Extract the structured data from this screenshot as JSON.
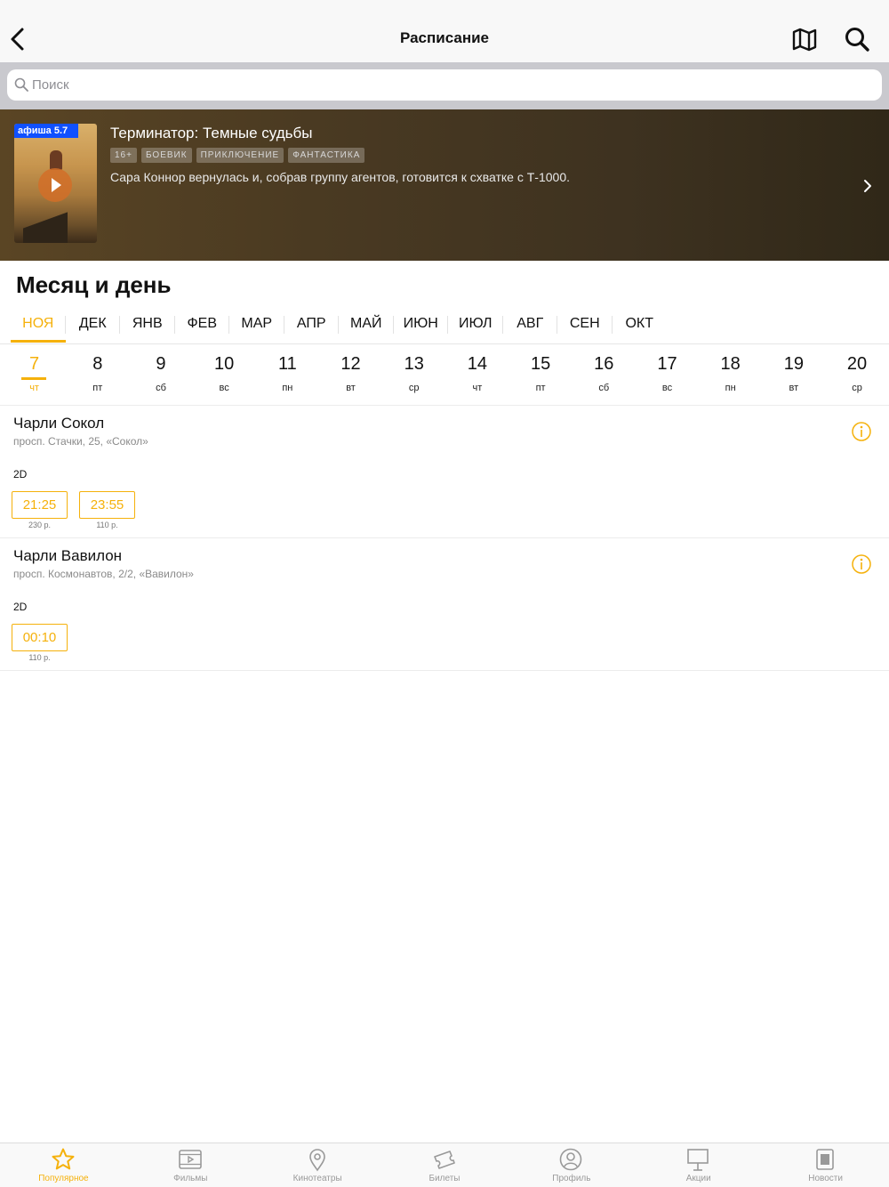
{
  "header": {
    "title": "Расписание",
    "icons": [
      "back-chevron-icon",
      "map-icon",
      "search-icon"
    ]
  },
  "search": {
    "placeholder": "Поиск"
  },
  "banner": {
    "poster_badge": "афиша 5.7",
    "title": "Терминатор: Темные судьбы",
    "tags": [
      "16+",
      "БОЕВИК",
      "ПРИКЛЮЧЕНИЕ",
      "ФАНТАСТИКА"
    ],
    "description": "Сара Коннор вернулась и, собрав группу агентов, готовится к схватке с Т-1000."
  },
  "schedule": {
    "section_title": "Месяц и день",
    "months": [
      "НОЯ",
      "ДЕК",
      "ЯНВ",
      "ФЕВ",
      "МАР",
      "АПР",
      "МАЙ",
      "ИЮН",
      "ИЮЛ",
      "АВГ",
      "СЕН",
      "ОКТ"
    ],
    "active_month": "НОЯ",
    "days": [
      {
        "num": "7",
        "wd": "чт"
      },
      {
        "num": "8",
        "wd": "пт"
      },
      {
        "num": "9",
        "wd": "сб"
      },
      {
        "num": "10",
        "wd": "вс"
      },
      {
        "num": "11",
        "wd": "пн"
      },
      {
        "num": "12",
        "wd": "вт"
      },
      {
        "num": "13",
        "wd": "ср"
      },
      {
        "num": "14",
        "wd": "чт"
      },
      {
        "num": "15",
        "wd": "пт"
      },
      {
        "num": "16",
        "wd": "сб"
      },
      {
        "num": "17",
        "wd": "вс"
      },
      {
        "num": "18",
        "wd": "пн"
      },
      {
        "num": "19",
        "wd": "вт"
      },
      {
        "num": "20",
        "wd": "ср"
      }
    ],
    "active_day": "7"
  },
  "cinemas": [
    {
      "name": "Чарли Сокол",
      "address": "просп. Стачки, 25, «Сокол»",
      "format": "2D",
      "sessions": [
        {
          "time": "21:25",
          "price": "230 р."
        },
        {
          "time": "23:55",
          "price": "110 р."
        }
      ]
    },
    {
      "name": "Чарли Вавилон",
      "address": "просп. Космонавтов, 2/2, «Вавилон»",
      "format": "2D",
      "sessions": [
        {
          "time": "00:10",
          "price": "110 р."
        }
      ]
    }
  ],
  "tabbar": [
    {
      "label": "Популярное",
      "icon": "star-icon",
      "active": true
    },
    {
      "label": "Фильмы",
      "icon": "film-icon",
      "active": false
    },
    {
      "label": "Кинотеатры",
      "icon": "location-pin-icon",
      "active": false
    },
    {
      "label": "Билеты",
      "icon": "tickets-icon",
      "active": false
    },
    {
      "label": "Профиль",
      "icon": "profile-icon",
      "active": false
    },
    {
      "label": "Акции",
      "icon": "billboard-icon",
      "active": false
    },
    {
      "label": "Новости",
      "icon": "news-icon",
      "active": false
    }
  ],
  "colors": {
    "accent": "#f5b10b",
    "banner_bg": "#4a3a22",
    "text": "#111111"
  }
}
